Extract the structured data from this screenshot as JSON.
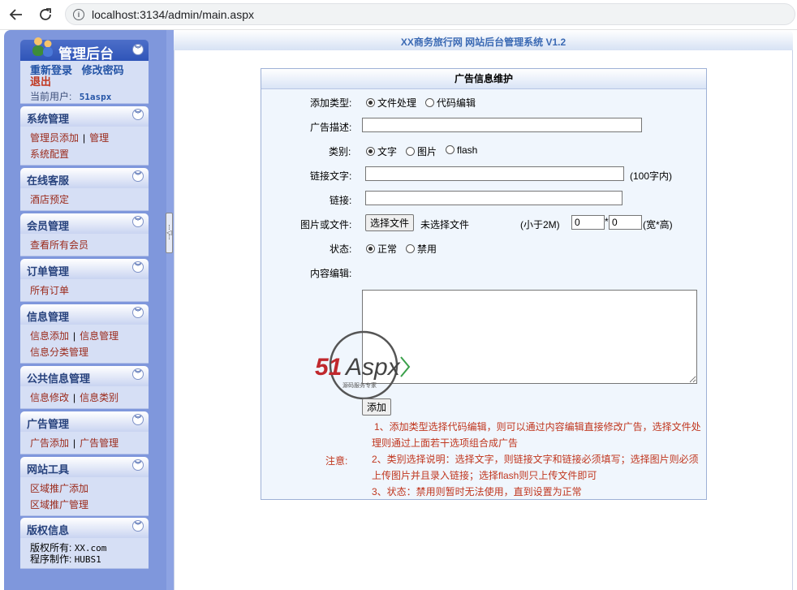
{
  "browser": {
    "url": "localhost:3134/admin/main.aspx"
  },
  "sidebar": {
    "title": "管理后台",
    "top_links": {
      "relogin": "重新登录",
      "change_pwd": "修改密码",
      "logout": "退出"
    },
    "current_user_label": "当前用户:",
    "current_user": "51aspx",
    "sections": [
      {
        "title": "系统管理",
        "rows": [
          [
            "管理员添加",
            "管理"
          ],
          [
            "系统配置"
          ]
        ]
      },
      {
        "title": "在线客服",
        "rows": [
          [
            "酒店预定"
          ]
        ]
      },
      {
        "title": "会员管理",
        "rows": [
          [
            "查看所有会员"
          ]
        ]
      },
      {
        "title": "订单管理",
        "rows": [
          [
            "所有订单"
          ]
        ]
      },
      {
        "title": "信息管理",
        "rows": [
          [
            "信息添加",
            "信息管理"
          ],
          [
            "信息分类管理"
          ]
        ]
      },
      {
        "title": "公共信息管理",
        "rows": [
          [
            "信息修改",
            "信息类别"
          ]
        ]
      },
      {
        "title": "广告管理",
        "rows": [
          [
            "广告添加",
            "广告管理"
          ]
        ]
      },
      {
        "title": "网站工具",
        "rows": [
          [
            "区域推广添加"
          ],
          [
            "区域推广管理"
          ]
        ]
      }
    ],
    "copyright": {
      "title": "版权信息",
      "owner_label": "版权所有:",
      "owner": "XX.com",
      "author_label": "程序制作:",
      "author": "HUBS1"
    }
  },
  "header": {
    "title": "XX商务旅行网 网站后台管理系统 V1.2"
  },
  "form": {
    "title": "广告信息维护",
    "add_type_label": "添加类型:",
    "add_type_options": [
      "文件处理",
      "代码编辑"
    ],
    "add_type_selected": "文件处理",
    "desc_label": "广告描述:",
    "desc_value": "",
    "category_label": "类别:",
    "category_options": [
      "文字",
      "图片",
      "flash"
    ],
    "category_selected": "文字",
    "link_text_label": "链接文字:",
    "link_text_value": "",
    "link_text_hint": "(100字内)",
    "link_label": "链接:",
    "link_value": "",
    "file_label": "图片或文件:",
    "file_button": "选择文件",
    "file_status": "未选择文件",
    "size_hint": "(小于2M)",
    "width_value": "0",
    "times": "*",
    "height_value": "0",
    "wh_hint": "(宽*高)",
    "status_label": "状态:",
    "status_options": [
      "正常",
      "禁用"
    ],
    "status_selected": "正常",
    "content_label": "内容编辑:",
    "submit_label": "添加",
    "notice_label": "注意:",
    "notes": [
      "1、添加类型选择代码编辑，则可以通过内容编辑直接修改广告，选择文件处",
      "理则通过上面若干选项组合成广告",
      "2、类别选择说明：选择文字，则链接文字和链接必须填写；选择图片则必须",
      "上传图片并且录入链接；选择flash则只上传文件即可",
      "3、状态：禁用则暂时无法使用，直到设置为正常"
    ]
  },
  "watermark": {
    "brand": "51Aspx",
    "tagline": "源码服务专家"
  },
  "colors": {
    "sidebar": "#7f97dc",
    "link_red": "#9b2a1b",
    "note_red": "#c0361e",
    "header_blue": "#3b6ab4"
  }
}
